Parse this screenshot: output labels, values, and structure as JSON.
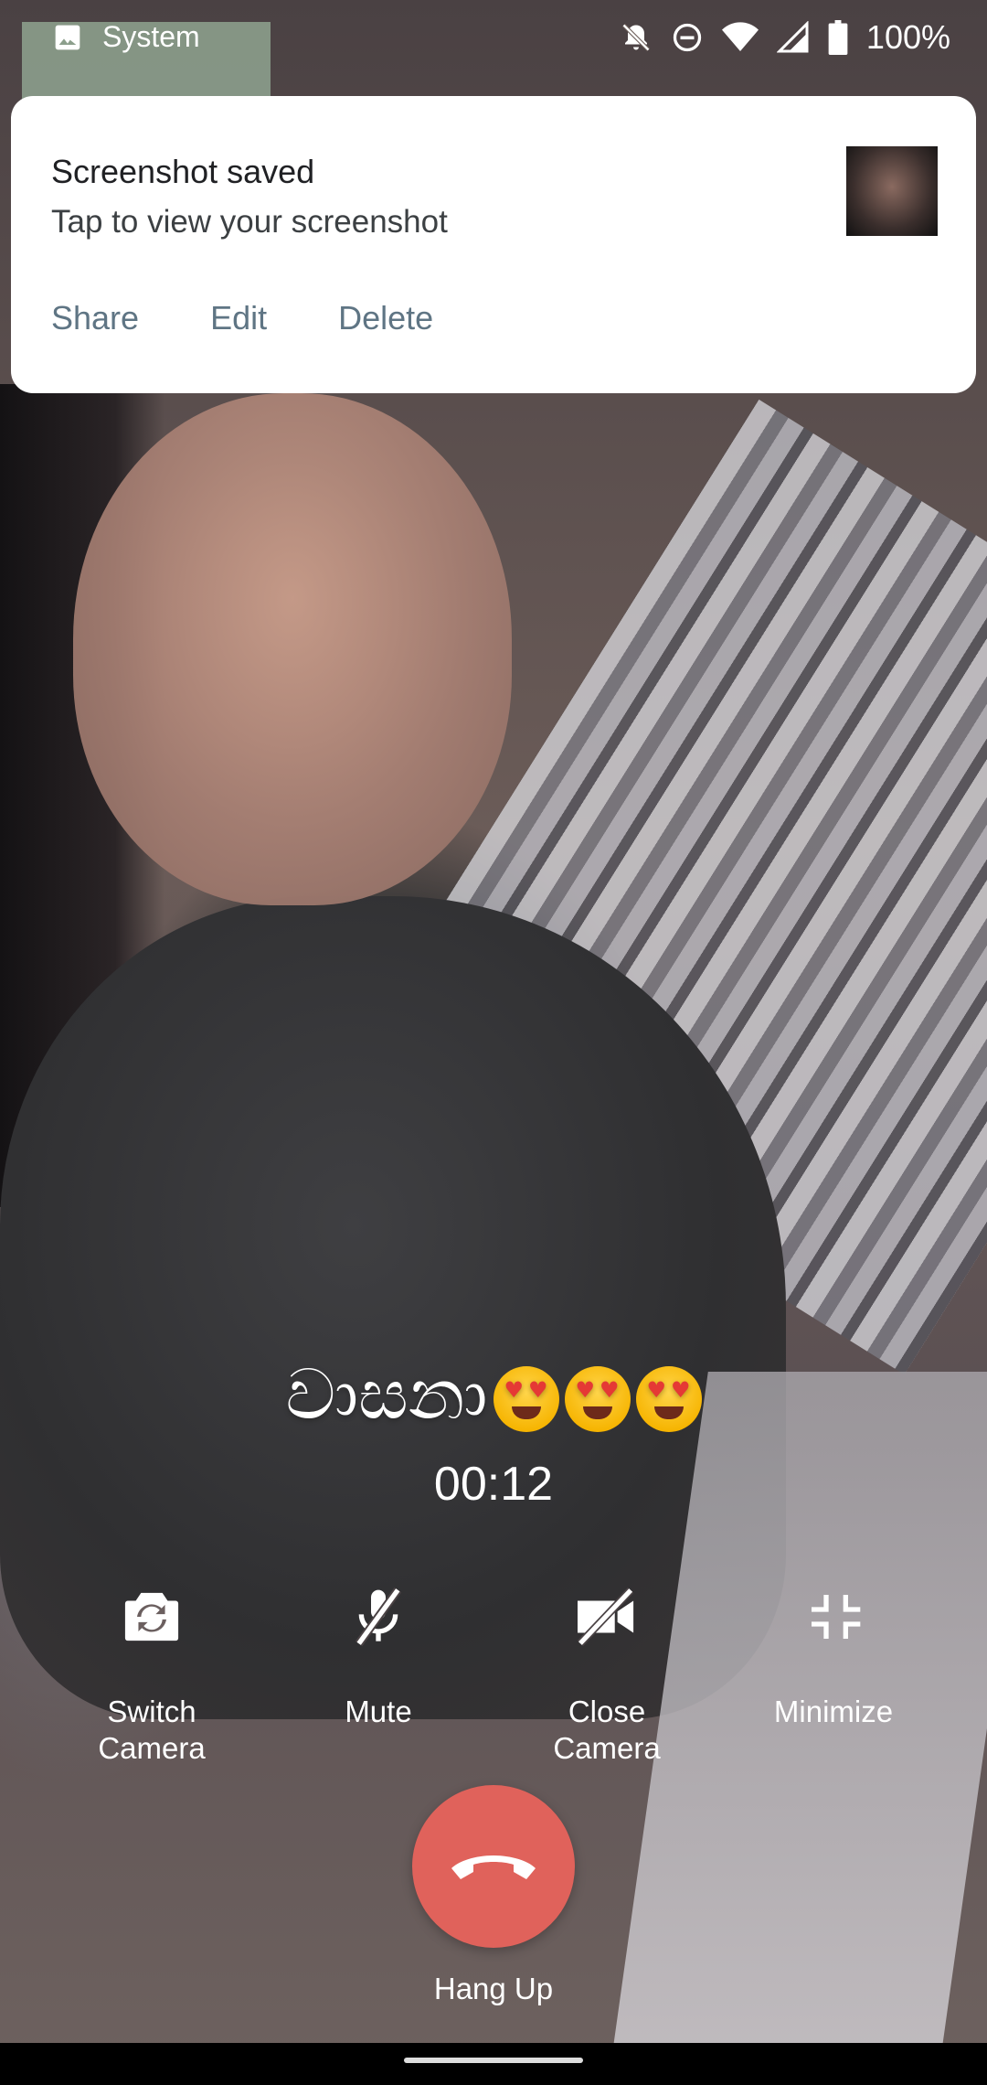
{
  "status_bar": {
    "notification_app": "System",
    "battery_level": "100%",
    "icons": [
      "image-icon",
      "notifications-off-icon",
      "do-not-disturb-icon",
      "wifi-icon",
      "cellular-signal-icon",
      "battery-icon"
    ]
  },
  "notification": {
    "title": "Screenshot saved",
    "text": "Tap to view your screenshot",
    "actions": {
      "share": "Share",
      "edit": "Edit",
      "delete": "Delete"
    },
    "action_color": "#5f7584"
  },
  "call": {
    "caller_name": "වාසනා",
    "caller_emojis": [
      "smiling-face-with-heart-eyes",
      "smiling-face-with-heart-eyes",
      "smiling-face-with-heart-eyes"
    ],
    "timer": "00:12"
  },
  "controls": {
    "switch_camera": "Switch\nCamera",
    "mute": "Mute",
    "close_camera": "Close\nCamera",
    "minimize": "Minimize",
    "hang_up": "Hang Up",
    "hang_up_color": "#e0625b"
  }
}
